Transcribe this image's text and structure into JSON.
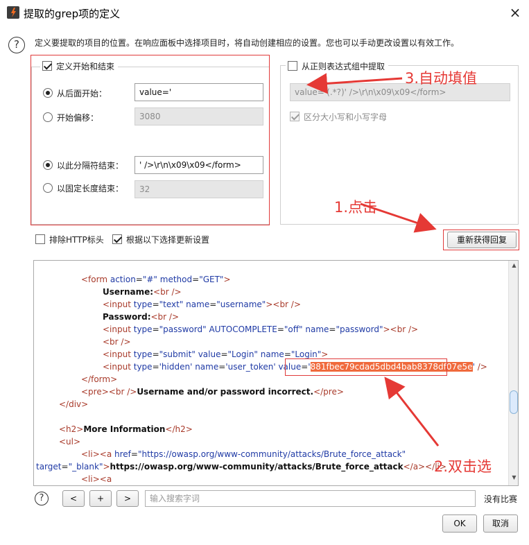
{
  "window": {
    "title": "提取的grep项的定义",
    "close_icon": "×"
  },
  "description": "定义要提取的项目的位置。在响应面板中选择项目时，将自动创建相应的设置。您也可以手动更改设置以有效工作。",
  "left_group": {
    "legend": "定义开始和结束",
    "legend_checked": true,
    "start_after": {
      "label": "从后面开始：",
      "value": "value='",
      "selected": true
    },
    "start_offset": {
      "label": "开始偏移：",
      "value": "3080",
      "selected": false
    },
    "end_delimiter": {
      "label": "以此分隔符结束：",
      "value": "' />\\r\\n\\x09\\x09</form>",
      "selected": true
    },
    "end_fixed_length": {
      "label": "以固定长度结束：",
      "value": "32",
      "selected": false
    }
  },
  "right_group": {
    "legend": "从正则表达式组中提取",
    "legend_checked": false,
    "regex_value": "value='(.*?)' />\\r\\n\\x09\\x09</form>",
    "case_sensitive_label": "区分大小写和小写字母",
    "case_sensitive_checked": true
  },
  "options": {
    "exclude_http_headers": {
      "label": "排除HTTP标头",
      "checked": false
    },
    "update_config": {
      "label": "根据以下选择更新设置",
      "checked": true
    }
  },
  "refetch_button": "重新获得回复",
  "annotations": {
    "step1": "1.点击",
    "step2": "2.双击选",
    "step3": "3.自动填值"
  },
  "code": {
    "l1": {
      "t1": "<form ",
      "a1": "action",
      "e1": "=",
      "v1": "\"#\"",
      "sp": " ",
      "a2": "method",
      "e2": "=",
      "v2": "\"GET\"",
      "t2": ">"
    },
    "l2": {
      "b": "Username:",
      "t": "<br />"
    },
    "l3": {
      "t1": "<input ",
      "a1": "type",
      "e1": "=",
      "v1": "\"text\"",
      "a2": " name",
      "e2": "=",
      "v2": "\"username\"",
      "t2": "><br />"
    },
    "l4": {
      "b": "Password:",
      "t": "<br />"
    },
    "l5": {
      "t1": "<input ",
      "a1": "type",
      "e1": "=",
      "v1": "\"password\"",
      "a2": " AUTOCOMPLETE",
      "e2": "=",
      "v2": "\"off\"",
      "a3": " name",
      "e3": "=",
      "v3": "\"password\"",
      "t2": "><br />"
    },
    "l6": {
      "t": "<br />"
    },
    "l7": {
      "t1": "<input ",
      "a1": "type",
      "e1": "=",
      "v1": "\"submit\"",
      "a2": " value",
      "e2": "=",
      "v2": "\"Login\"",
      "a3": " name",
      "e3": "=",
      "v3": "\"Login\"",
      "t2": ">"
    },
    "l8": {
      "t1": "<input ",
      "a1": "type",
      "e1": "=",
      "v1": "'hidden'",
      "a2": " name",
      "e2": "=",
      "v2": "'user_token'",
      "a3": " value",
      "e3": "=",
      "q": "'",
      "token": "881fbec79cdad5dbd4bab8378df07e5e",
      "q2": "'",
      "t2": " />"
    },
    "l9": {
      "t": "</form>"
    },
    "l10": {
      "t1": "<pre>",
      "t2": "<br />",
      "b": "Username and/or password incorrect.",
      "t3": "</pre>"
    },
    "l11": {
      "t": "</div>"
    },
    "l12": {
      "t1": "<h2>",
      "b": "More Information",
      "t2": "</h2>"
    },
    "l13": {
      "t": "<ul>"
    },
    "l14": {
      "t1": "<li>",
      "t2": "<a ",
      "a1": "href",
      "e1": "=",
      "v1": "\"https://owasp.org/www-community/attacks/Brute_force_attack\""
    },
    "l15": {
      "a1": "target",
      "e1": "=",
      "v1": "\"_blank\"",
      "t1": ">",
      "b": "https://owasp.org/www-community/attacks/Brute_force_attack",
      "t2": "</a></li>"
    },
    "l16": {
      "t": "<li><a"
    }
  },
  "bottom": {
    "help_icon": "?",
    "prev_label": "<",
    "add_label": "+",
    "next_label": ">",
    "search_placeholder": "输入搜索字词",
    "match_status": "没有比赛"
  },
  "buttons": {
    "ok": "OK",
    "cancel": "取消"
  },
  "colors": {
    "annotation_red": "#e53935",
    "highlight": "#f06a3c",
    "tag": "#a83a2a",
    "attr": "#1f3aa5"
  }
}
